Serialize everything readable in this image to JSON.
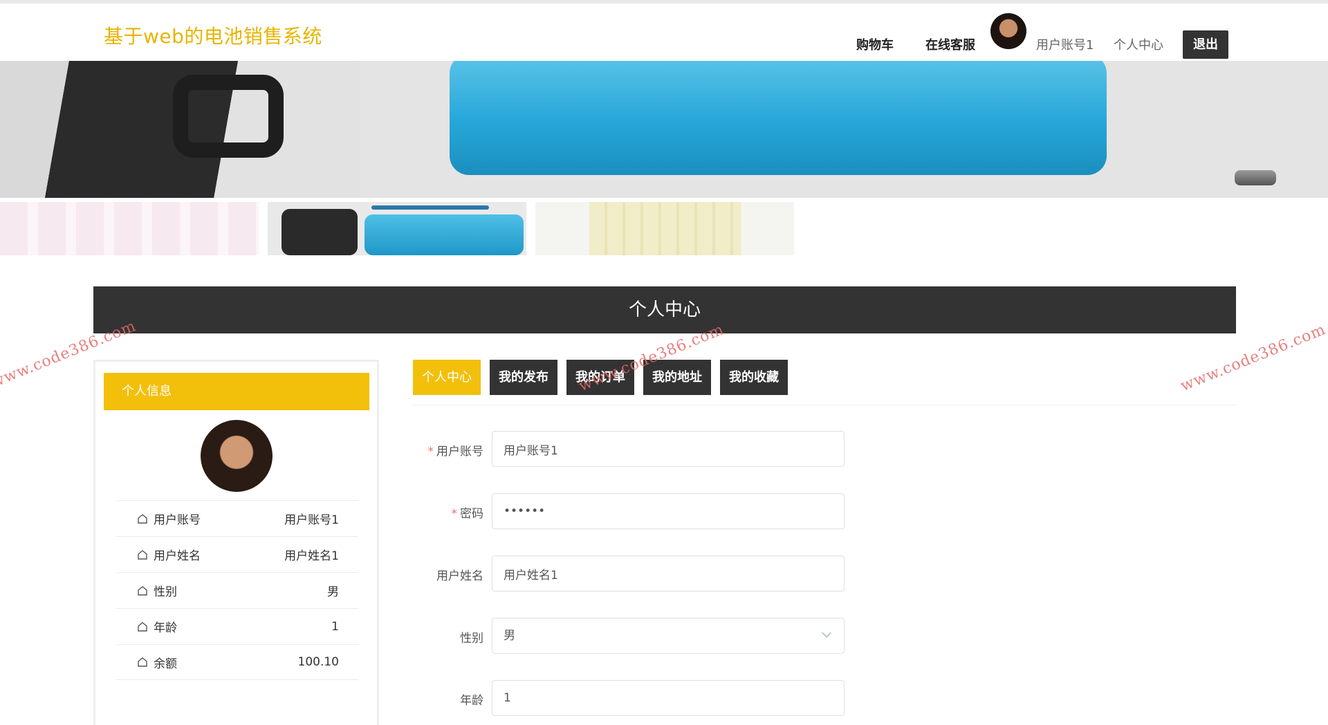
{
  "header": {
    "logo": "基于web的电池销售系统",
    "nav": {
      "cart": "购物车",
      "service": "在线客服",
      "username": "用户账号1",
      "center": "个人中心",
      "logout": "退出"
    }
  },
  "page_title": "个人中心",
  "left_panel": {
    "header": "个人信息",
    "rows": [
      {
        "label": "用户账号",
        "value": "用户账号1"
      },
      {
        "label": "用户姓名",
        "value": "用户姓名1"
      },
      {
        "label": "性别",
        "value": "男"
      },
      {
        "label": "年龄",
        "value": "1"
      },
      {
        "label": "余额",
        "value": "100.10"
      }
    ]
  },
  "tabs": [
    "个人中心",
    "我的发布",
    "我的订单",
    "我的地址",
    "我的收藏"
  ],
  "form": {
    "account_label": "用户账号",
    "account_value": "用户账号1",
    "password_label": "密码",
    "password_value": "••••••",
    "name_label": "用户姓名",
    "name_value": "用户姓名1",
    "gender_label": "性别",
    "gender_value": "男",
    "age_label": "年龄",
    "age_value": "1"
  },
  "watermark": "www.code386.com",
  "colors": {
    "accent": "#f2bf0a",
    "dark": "#333333",
    "logo": "#e8b400",
    "required": "#f56c6c"
  },
  "icons": {
    "info_row": "home-icon",
    "select": "chevron-down-icon"
  }
}
